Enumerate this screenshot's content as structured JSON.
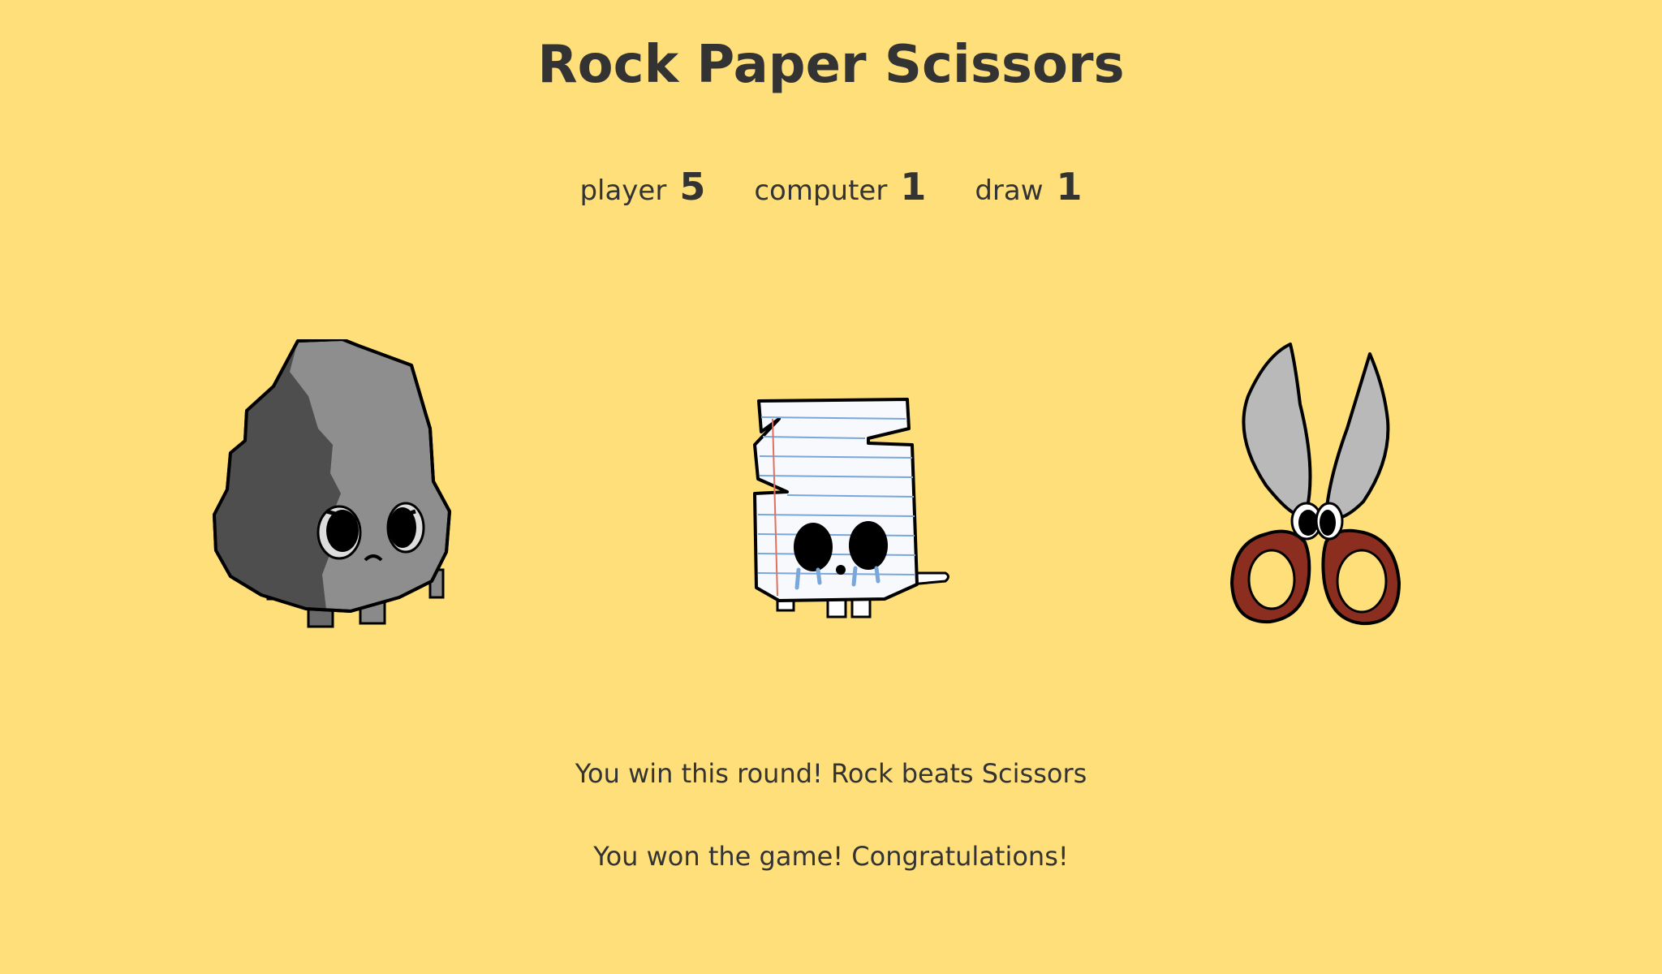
{
  "colors": {
    "background": "#FFDF7A",
    "text": "#333333"
  },
  "title": "Rock Paper Scissors",
  "scores": [
    {
      "label": "player",
      "value": "5"
    },
    {
      "label": "computer",
      "value": "1"
    },
    {
      "label": "draw",
      "value": "1"
    }
  ],
  "choices": [
    {
      "name": "rock",
      "icon": "rock-character-icon"
    },
    {
      "name": "paper",
      "icon": "paper-character-icon"
    },
    {
      "name": "scissors",
      "icon": "scissors-character-icon"
    }
  ],
  "messages": {
    "round": "You win this round! Rock beats Scissors",
    "game": "You won the game! Congratulations!"
  }
}
